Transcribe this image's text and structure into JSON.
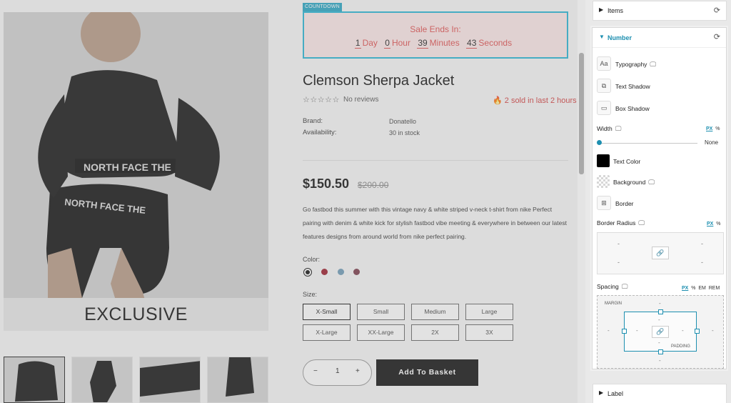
{
  "canvas": {
    "countdown_tag": "COUNTDOWN",
    "countdown": {
      "title": "Sale Ends In:",
      "units": [
        {
          "value": "1",
          "label": "Day"
        },
        {
          "value": "0",
          "label": "Hour"
        },
        {
          "value": "39",
          "label": "Minutes"
        },
        {
          "value": "43",
          "label": "Seconds"
        }
      ]
    },
    "gallery_badge": "EXCLUSIVE",
    "product": {
      "title": "Clemson Sherpa Jacket",
      "stars": "☆☆☆☆☆",
      "reviews": "No reviews",
      "sold_text": "2 sold in last 2 hours",
      "brand_label": "Brand:",
      "brand_value": "Donatello",
      "availability_label": "Availability:",
      "availability_value": "30 in stock",
      "price": "$150.50",
      "old_price": "$200.00",
      "description": "Go fastbod this summer with this vintage navy & white striped v-neck t-shirt from nike Perfect pairing with denim & white kick for stylish fastbod vibe meeting & everywhere in between our latest features designs from around world from nike perfect pairing.",
      "color_label": "Color:",
      "colors": [
        "#111111",
        "#9b1c2b",
        "#6f9cb7",
        "#7a3b4a"
      ],
      "size_label": "Size:",
      "sizes": [
        "X-Small",
        "Small",
        "Medium",
        "Large",
        "X-Large",
        "XX-Large",
        "2X",
        "3X"
      ],
      "selected_size": "X-Small",
      "qty_minus": "−",
      "qty_value": "1",
      "qty_plus": "+",
      "add_to_basket": "Add To Basket"
    }
  },
  "panel": {
    "items_section": "Items",
    "number_section": "Number",
    "label_section": "Label",
    "typography": "Typography",
    "text_shadow": "Text Shadow",
    "box_shadow": "Box Shadow",
    "width_label": "Width",
    "width_units": [
      "PX",
      "%"
    ],
    "width_value": "None",
    "text_color": "Text Color",
    "text_color_value": "#000000",
    "background": "Background",
    "border": "Border",
    "border_radius": "Border Radius",
    "radius_units": [
      "PX",
      "%"
    ],
    "radius_placeholder": "-",
    "spacing_label": "Spacing",
    "spacing_units": [
      "PX",
      "%",
      "EM",
      "REM"
    ],
    "margin_label": "MARGIN",
    "padding_label": "PADDING",
    "spacing_placeholder": "-",
    "active_unit": "PX",
    "accent_color": "#1d8fb0",
    "icons": {
      "typography": "font-icon",
      "text_shadow": "copy-icon",
      "box_shadow": "box-icon",
      "border": "grid-icon",
      "reset": "refresh-icon",
      "responsive": "monitor-icon",
      "link": "link-icon"
    }
  }
}
